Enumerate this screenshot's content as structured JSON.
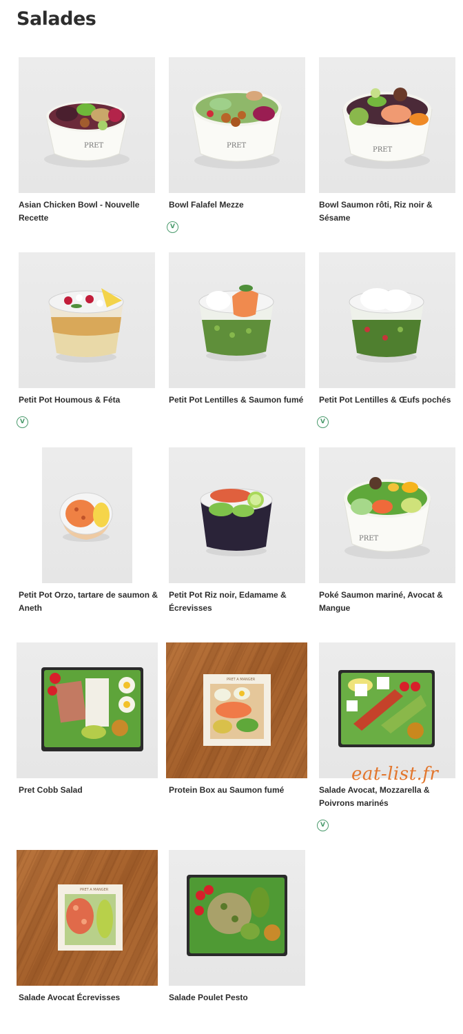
{
  "page": {
    "title": "Salades",
    "watermark": "eat-list.fr"
  },
  "products": [
    {
      "name": "Asian Chicken Bowl - Nouvelle Recette",
      "vegetarian": false,
      "image": "bowl"
    },
    {
      "name": "Bowl Falafel Mezze",
      "vegetarian": true,
      "veg_badge": "V",
      "image": "bowl"
    },
    {
      "name": "Bowl Saumon rôti, Riz noir & Sésame",
      "vegetarian": false,
      "image": "bowl"
    },
    {
      "name": "Petit Pot Houmous & Féta",
      "vegetarian": true,
      "veg_badge": "V",
      "image": "pot"
    },
    {
      "name": "Petit Pot Lentilles & Saumon fumé",
      "vegetarian": false,
      "image": "pot"
    },
    {
      "name": "Petit Pot Lentilles & Œufs pochés",
      "vegetarian": true,
      "veg_badge": "V",
      "image": "pot"
    },
    {
      "name": "Petit Pot Orzo, tartare de saumon & Aneth",
      "vegetarian": false,
      "image": "small-pot"
    },
    {
      "name": "Petit Pot Riz noir, Edamame & Écrevisses",
      "vegetarian": false,
      "image": "pot"
    },
    {
      "name": "Poké Saumon mariné, Avocat & Mangue",
      "vegetarian": false,
      "image": "bowl"
    },
    {
      "name": "Pret Cobb Salad",
      "vegetarian": false,
      "image": "salad-box"
    },
    {
      "name": "Protein Box au Saumon fumé",
      "vegetarian": false,
      "image": "wood-box"
    },
    {
      "name": "Salade Avocat, Mozzarella & Poivrons marinés",
      "vegetarian": true,
      "veg_badge": "V",
      "image": "salad-box"
    },
    {
      "name": "Salade Avocat Écrevisses",
      "vegetarian": false,
      "image": "wood-box"
    },
    {
      "name": "Salade Poulet Pesto",
      "vegetarian": false,
      "image": "salad-box"
    }
  ],
  "colors": {
    "veg_badge": "#4a9a6c",
    "watermark": "#e2762d",
    "text": "#2d2d2d"
  }
}
